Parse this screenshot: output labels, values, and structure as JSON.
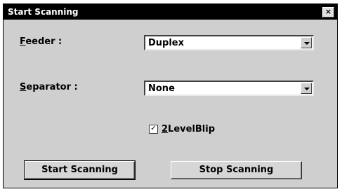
{
  "window": {
    "title": "Start Scanning",
    "close_glyph": "×"
  },
  "feeder": {
    "label_underlined": "F",
    "label_rest": "eeder :",
    "value": "Duplex"
  },
  "separator": {
    "label_underlined": "S",
    "label_rest": "eparator :",
    "value": "None"
  },
  "checkbox": {
    "checked_glyph": "✓",
    "label_underlined": "2",
    "label_rest": "LevelBlip",
    "checked": true
  },
  "buttons": {
    "start": "Start Scanning",
    "stop": "Stop Scanning"
  }
}
